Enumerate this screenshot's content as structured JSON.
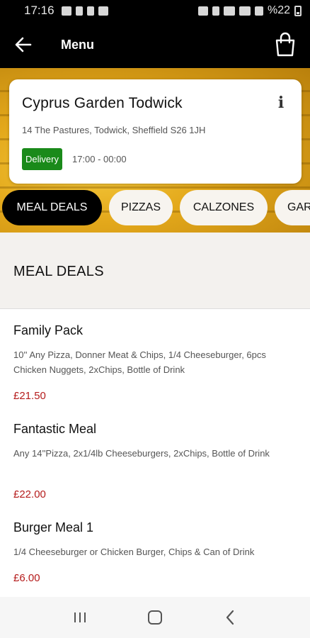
{
  "status_bar": {
    "time": "17:16",
    "battery": "%22"
  },
  "header": {
    "title": "Menu"
  },
  "restaurant": {
    "name": "Cyprus Garden Todwick",
    "address": "14 The Pastures, Todwick, Sheffield S26 1JH",
    "badge": "Delivery",
    "hours": "17:00 - 00:00",
    "info_glyph": "i",
    "badge_color": "#1a8a1a"
  },
  "categories": [
    {
      "label": "MEAL DEALS",
      "active": true
    },
    {
      "label": "PIZZAS",
      "active": false
    },
    {
      "label": "CALZONES",
      "active": false
    },
    {
      "label": "GAR",
      "active": false
    }
  ],
  "section": {
    "title": "MEAL DEALS"
  },
  "items": [
    {
      "name": "Family Pack",
      "description": "10'' Any Pizza, Donner Meat & Chips, 1/4 Cheeseburger, 6pcs Chicken Nuggets, 2xChips, Bottle of Drink",
      "price": "£21.50"
    },
    {
      "name": "Fantastic Meal",
      "description": "Any 14''Pizza, 2x1/4lb Cheeseburgers, 2xChips, Bottle of Drink",
      "price": "£22.00"
    },
    {
      "name": "Burger Meal 1",
      "description": "1/4 Cheeseburger or Chicken Burger, Chips & Can of Drink",
      "price": "£6.00"
    }
  ],
  "colors": {
    "price": "#b51c1c",
    "header_bg": "#000000",
    "banner": "#e3a81b"
  },
  "icons": [
    "back-arrow-icon",
    "shopping-bag-icon",
    "info-icon",
    "recents-icon",
    "home-icon",
    "back-nav-icon"
  ]
}
